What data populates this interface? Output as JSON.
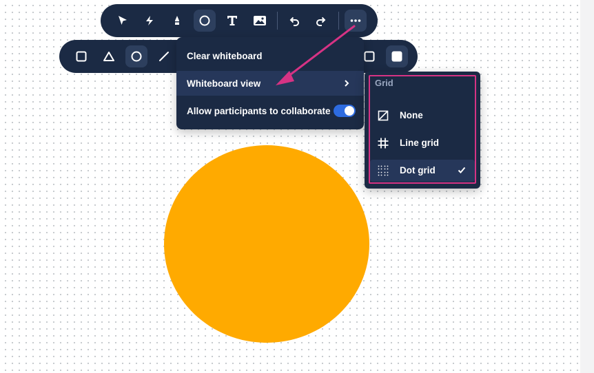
{
  "canvas": {
    "grid": "dot",
    "shape": {
      "type": "circle",
      "fill": "#FFAA00"
    }
  },
  "main_toolbar": {
    "tools": [
      {
        "name": "select-icon",
        "active": false
      },
      {
        "name": "laser-pointer-icon",
        "active": false
      },
      {
        "name": "highlighter-icon",
        "active": false
      },
      {
        "name": "shape-circle-icon",
        "active": true
      },
      {
        "name": "text-icon",
        "active": false
      },
      {
        "name": "image-icon",
        "active": false
      },
      {
        "name": "undo-icon",
        "active": false
      },
      {
        "name": "redo-icon",
        "active": false
      },
      {
        "name": "more-options-icon",
        "active": true
      }
    ]
  },
  "shape_toolbar": {
    "tools": [
      {
        "name": "rectangle-icon",
        "active": false
      },
      {
        "name": "triangle-icon",
        "active": false
      },
      {
        "name": "circle-icon",
        "active": true
      },
      {
        "name": "line-icon",
        "active": false
      },
      {
        "name": "stroke-style-icon",
        "active": false
      },
      {
        "name": "fill-style-icon",
        "active": true
      }
    ]
  },
  "menu": {
    "items": [
      {
        "label": "Clear whiteboard"
      },
      {
        "label": "Whiteboard view",
        "has_submenu": true
      },
      {
        "label": "Allow participants to collaborate",
        "toggle_on": true
      }
    ]
  },
  "submenu": {
    "title": "Grid",
    "options": [
      {
        "label": "None",
        "icon": "no-grid-icon",
        "selected": false
      },
      {
        "label": "Line grid",
        "icon": "line-grid-icon",
        "selected": false
      },
      {
        "label": "Dot grid",
        "icon": "dot-grid-icon",
        "selected": true
      }
    ]
  },
  "colors": {
    "toolbar_bg": "#1B2A44",
    "highlight": "#D63384",
    "toggle_on": "#2D6BE0",
    "shape_fill": "#FFAA00"
  }
}
